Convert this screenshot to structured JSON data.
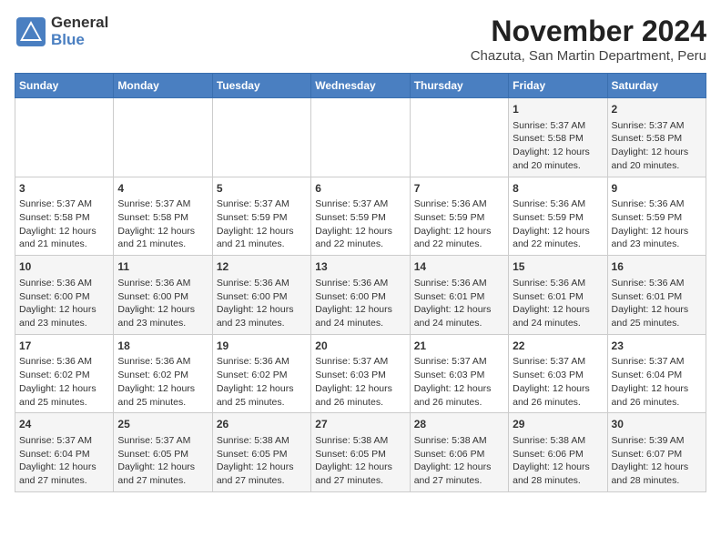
{
  "header": {
    "logo_line1": "General",
    "logo_line2": "Blue",
    "title": "November 2024",
    "subtitle": "Chazuta, San Martin Department, Peru"
  },
  "weekdays": [
    "Sunday",
    "Monday",
    "Tuesday",
    "Wednesday",
    "Thursday",
    "Friday",
    "Saturday"
  ],
  "weeks": [
    [
      {
        "day": "",
        "content": ""
      },
      {
        "day": "",
        "content": ""
      },
      {
        "day": "",
        "content": ""
      },
      {
        "day": "",
        "content": ""
      },
      {
        "day": "",
        "content": ""
      },
      {
        "day": "1",
        "content": "Sunrise: 5:37 AM\nSunset: 5:58 PM\nDaylight: 12 hours and 20 minutes."
      },
      {
        "day": "2",
        "content": "Sunrise: 5:37 AM\nSunset: 5:58 PM\nDaylight: 12 hours and 20 minutes."
      }
    ],
    [
      {
        "day": "3",
        "content": "Sunrise: 5:37 AM\nSunset: 5:58 PM\nDaylight: 12 hours and 21 minutes."
      },
      {
        "day": "4",
        "content": "Sunrise: 5:37 AM\nSunset: 5:58 PM\nDaylight: 12 hours and 21 minutes."
      },
      {
        "day": "5",
        "content": "Sunrise: 5:37 AM\nSunset: 5:59 PM\nDaylight: 12 hours and 21 minutes."
      },
      {
        "day": "6",
        "content": "Sunrise: 5:37 AM\nSunset: 5:59 PM\nDaylight: 12 hours and 22 minutes."
      },
      {
        "day": "7",
        "content": "Sunrise: 5:36 AM\nSunset: 5:59 PM\nDaylight: 12 hours and 22 minutes."
      },
      {
        "day": "8",
        "content": "Sunrise: 5:36 AM\nSunset: 5:59 PM\nDaylight: 12 hours and 22 minutes."
      },
      {
        "day": "9",
        "content": "Sunrise: 5:36 AM\nSunset: 5:59 PM\nDaylight: 12 hours and 23 minutes."
      }
    ],
    [
      {
        "day": "10",
        "content": "Sunrise: 5:36 AM\nSunset: 6:00 PM\nDaylight: 12 hours and 23 minutes."
      },
      {
        "day": "11",
        "content": "Sunrise: 5:36 AM\nSunset: 6:00 PM\nDaylight: 12 hours and 23 minutes."
      },
      {
        "day": "12",
        "content": "Sunrise: 5:36 AM\nSunset: 6:00 PM\nDaylight: 12 hours and 23 minutes."
      },
      {
        "day": "13",
        "content": "Sunrise: 5:36 AM\nSunset: 6:00 PM\nDaylight: 12 hours and 24 minutes."
      },
      {
        "day": "14",
        "content": "Sunrise: 5:36 AM\nSunset: 6:01 PM\nDaylight: 12 hours and 24 minutes."
      },
      {
        "day": "15",
        "content": "Sunrise: 5:36 AM\nSunset: 6:01 PM\nDaylight: 12 hours and 24 minutes."
      },
      {
        "day": "16",
        "content": "Sunrise: 5:36 AM\nSunset: 6:01 PM\nDaylight: 12 hours and 25 minutes."
      }
    ],
    [
      {
        "day": "17",
        "content": "Sunrise: 5:36 AM\nSunset: 6:02 PM\nDaylight: 12 hours and 25 minutes."
      },
      {
        "day": "18",
        "content": "Sunrise: 5:36 AM\nSunset: 6:02 PM\nDaylight: 12 hours and 25 minutes."
      },
      {
        "day": "19",
        "content": "Sunrise: 5:36 AM\nSunset: 6:02 PM\nDaylight: 12 hours and 25 minutes."
      },
      {
        "day": "20",
        "content": "Sunrise: 5:37 AM\nSunset: 6:03 PM\nDaylight: 12 hours and 26 minutes."
      },
      {
        "day": "21",
        "content": "Sunrise: 5:37 AM\nSunset: 6:03 PM\nDaylight: 12 hours and 26 minutes."
      },
      {
        "day": "22",
        "content": "Sunrise: 5:37 AM\nSunset: 6:03 PM\nDaylight: 12 hours and 26 minutes."
      },
      {
        "day": "23",
        "content": "Sunrise: 5:37 AM\nSunset: 6:04 PM\nDaylight: 12 hours and 26 minutes."
      }
    ],
    [
      {
        "day": "24",
        "content": "Sunrise: 5:37 AM\nSunset: 6:04 PM\nDaylight: 12 hours and 27 minutes."
      },
      {
        "day": "25",
        "content": "Sunrise: 5:37 AM\nSunset: 6:05 PM\nDaylight: 12 hours and 27 minutes."
      },
      {
        "day": "26",
        "content": "Sunrise: 5:38 AM\nSunset: 6:05 PM\nDaylight: 12 hours and 27 minutes."
      },
      {
        "day": "27",
        "content": "Sunrise: 5:38 AM\nSunset: 6:05 PM\nDaylight: 12 hours and 27 minutes."
      },
      {
        "day": "28",
        "content": "Sunrise: 5:38 AM\nSunset: 6:06 PM\nDaylight: 12 hours and 27 minutes."
      },
      {
        "day": "29",
        "content": "Sunrise: 5:38 AM\nSunset: 6:06 PM\nDaylight: 12 hours and 28 minutes."
      },
      {
        "day": "30",
        "content": "Sunrise: 5:39 AM\nSunset: 6:07 PM\nDaylight: 12 hours and 28 minutes."
      }
    ]
  ]
}
